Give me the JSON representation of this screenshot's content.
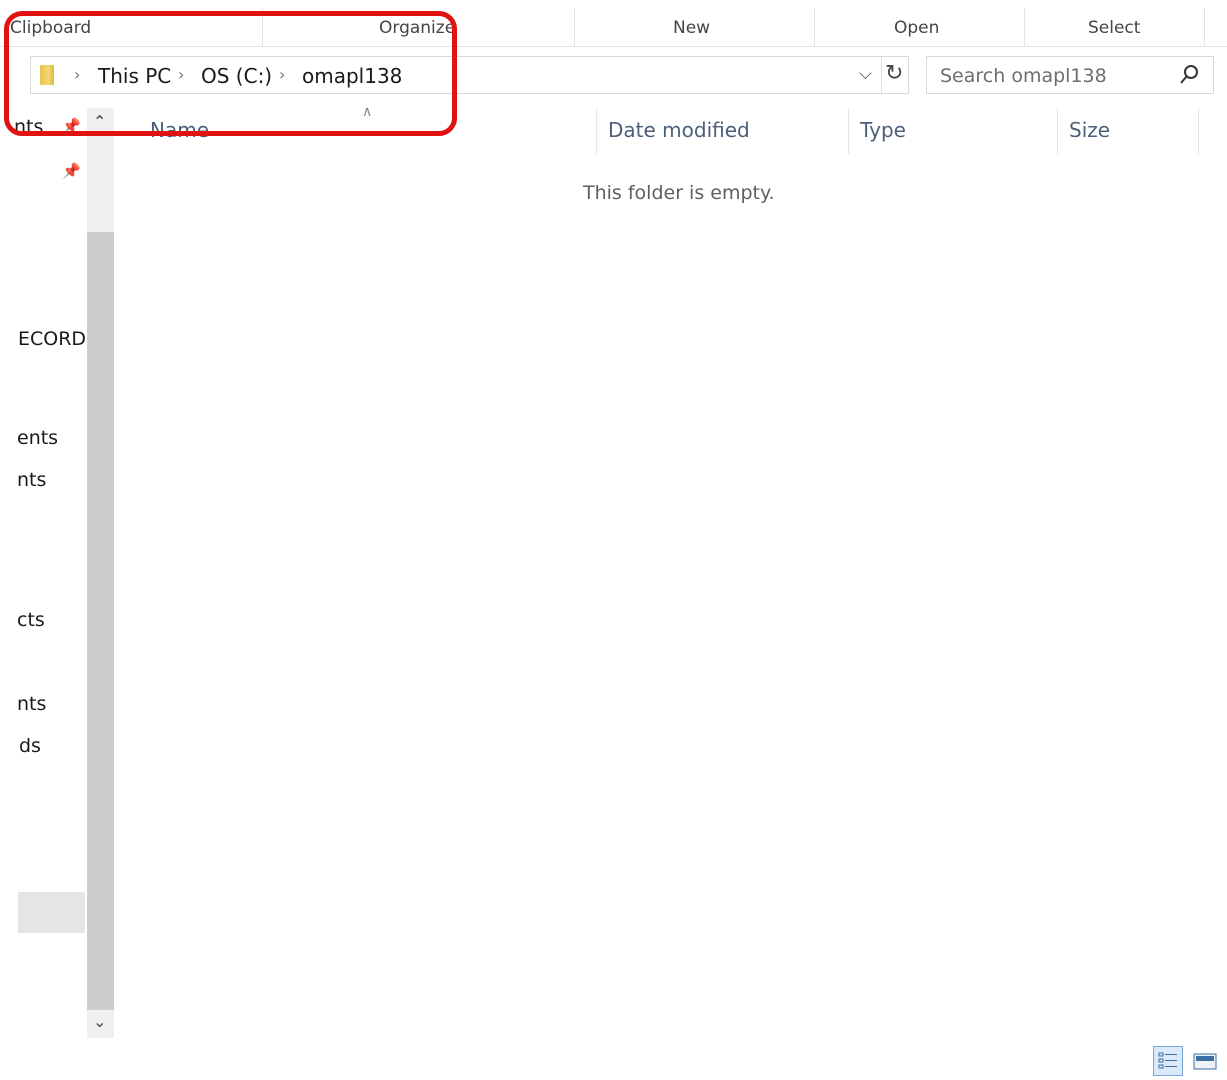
{
  "ribbon": {
    "groups": [
      "Clipboard",
      "Organize",
      "New",
      "Open",
      "Select"
    ]
  },
  "address_bar": {
    "crumbs": [
      "This PC",
      "OS (C:)",
      "omapl138"
    ]
  },
  "search": {
    "placeholder": "Search omapl138"
  },
  "nav_pane": {
    "items": [
      "nts",
      "ECORDI",
      "ents",
      "nts",
      "cts",
      "nts",
      "ds"
    ]
  },
  "columns": {
    "name": "Name",
    "date_modified": "Date modified",
    "type": "Type",
    "size": "Size"
  },
  "content": {
    "empty_message": "This folder is empty."
  },
  "colors": {
    "annotation": "#e11212",
    "header_text": "#4c607a",
    "folder": "#f3d775"
  }
}
